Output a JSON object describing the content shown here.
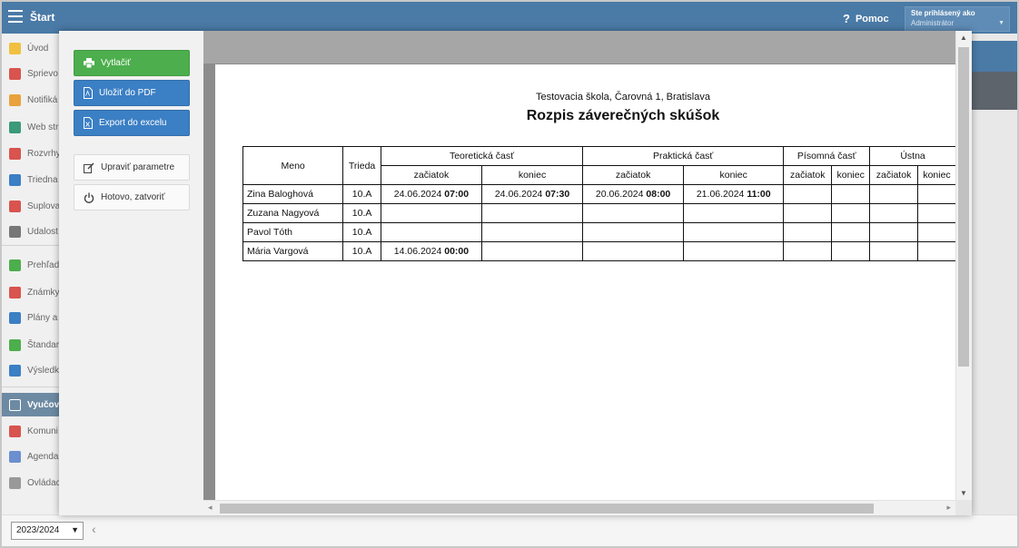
{
  "header": {
    "app_title": "Štart",
    "help_label": "Pomoc",
    "user_line1": "Ste prihlásený ako",
    "user_line2": "Administrátor"
  },
  "sidebar": {
    "items": [
      {
        "label": "Úvod",
        "icon": "star-icon",
        "color": "#f0c040"
      },
      {
        "label": "Sprievo",
        "icon": "wand-icon",
        "color": "#d9534f"
      },
      {
        "label": "Notifiká",
        "icon": "envelope-icon",
        "color": "#e8a33d"
      },
      {
        "label": "Web str",
        "icon": "home-icon",
        "color": "#3a9a7a"
      },
      {
        "label": "Rozvrhy",
        "icon": "calendar-icon",
        "color": "#d9534f"
      },
      {
        "label": "Triedna",
        "icon": "book-icon",
        "color": "#3b7fc4"
      },
      {
        "label": "Suplova",
        "icon": "person-icon",
        "color": "#d9534f"
      },
      {
        "label": "Udalost",
        "icon": "calendar-grid-icon",
        "color": "#777777"
      },
      {
        "label": "Prehľad",
        "icon": "check-circle-icon",
        "color": "#4cae4c"
      },
      {
        "label": "Známky",
        "icon": "grade-icon",
        "color": "#d9534f"
      },
      {
        "label": "Plány a",
        "icon": "briefcase-icon",
        "color": "#3b7fc4"
      },
      {
        "label": "Štandar",
        "icon": "shield-icon",
        "color": "#4cae4c"
      },
      {
        "label": "Výsledk",
        "icon": "bar-chart-icon",
        "color": "#3b7fc4"
      },
      {
        "label": "Vyučov",
        "icon": "open-book-icon",
        "color": "#ffffff"
      },
      {
        "label": "Komuni",
        "icon": "chat-icon",
        "color": "#d9534f"
      },
      {
        "label": "Agenda",
        "icon": "pencil-icon",
        "color": "#6b8fcf"
      },
      {
        "label": "Ovládac",
        "icon": "gear-icon",
        "color": "#999999"
      }
    ]
  },
  "footer": {
    "school_year": "2023/2024"
  },
  "modal": {
    "buttons": {
      "print": "Vytlačiť",
      "pdf": "Uložiť do PDF",
      "excel": "Export do excelu",
      "edit": "Upraviť parametre",
      "done": "Hotovo, zatvoriť"
    },
    "document": {
      "school": "Testovacia škola, Čarovná 1, Bratislava",
      "title": "Rozpis záverečných skúšok",
      "headers": {
        "name": "Meno",
        "class": "Trieda",
        "groups": [
          "Teoretická časť",
          "Praktická časť",
          "Písomná časť",
          "Ústna"
        ],
        "start": "začiatok",
        "end": "koniec"
      },
      "rows": [
        {
          "name": "Zina Baloghová",
          "class": "10.A",
          "teo_start_date": "24.06.2024",
          "teo_start_time": "07:00",
          "teo_end_date": "24.06.2024",
          "teo_end_time": "07:30",
          "prak_start_date": "20.06.2024",
          "prak_start_time": "08:00",
          "prak_end_date": "21.06.2024",
          "prak_end_time": "11:00"
        },
        {
          "name": "Zuzana Nagyová",
          "class": "10.A"
        },
        {
          "name": "Pavol Tóth",
          "class": "10.A"
        },
        {
          "name": "Mária Vargová",
          "class": "10.A",
          "teo_start_date": "14.06.2024",
          "teo_start_time": "00:00"
        }
      ]
    }
  }
}
